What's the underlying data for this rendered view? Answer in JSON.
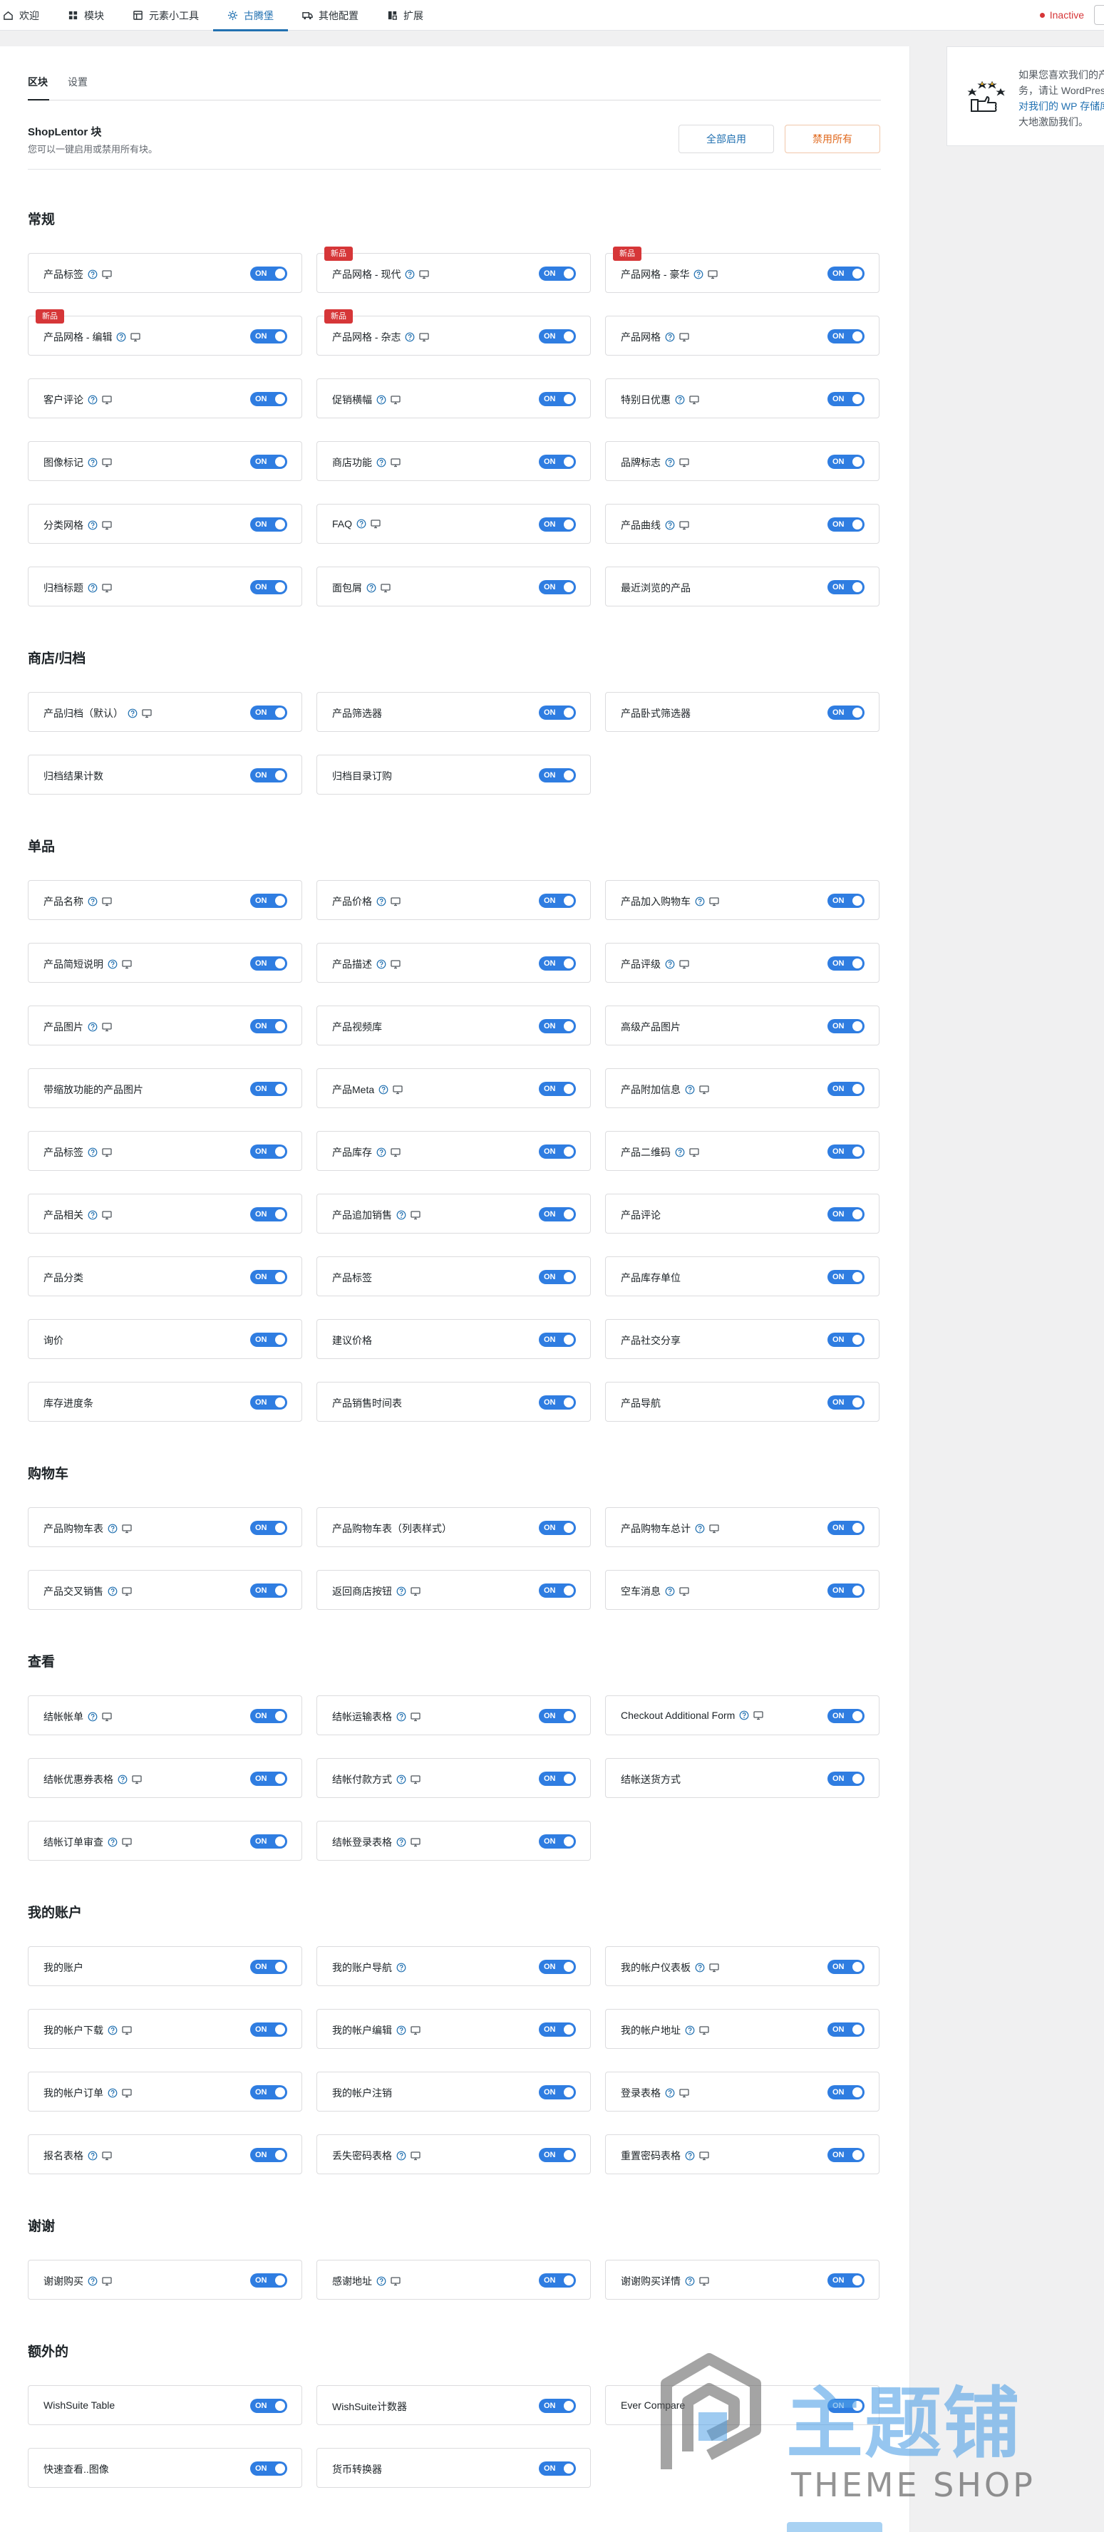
{
  "topnav": {
    "items": [
      {
        "label": "欢迎",
        "icon": "house-icon"
      },
      {
        "label": "模块",
        "icon": "grid-icon"
      },
      {
        "label": "元素小工具",
        "icon": "widgets-icon"
      },
      {
        "label": "古腾堡",
        "icon": "gear-icon"
      },
      {
        "label": "其他配置",
        "icon": "truck-icon"
      },
      {
        "label": "扩展",
        "icon": "extension-icon"
      }
    ],
    "active_index": 3,
    "status": "Inactive",
    "status_color": "#d63638",
    "accent_color": "#2271b1"
  },
  "sidebar": {
    "lines": [
      "如果您喜欢我们的产",
      "务，请让 WordPres",
      "对我们的 WP 存储库",
      "大地激励我们。"
    ],
    "icon": "rating-hand-icon"
  },
  "tabs": [
    {
      "label": "区块"
    },
    {
      "label": "设置"
    }
  ],
  "header": {
    "title": "ShopLentor 块",
    "desc": "您可以一键启用或禁用所有块。",
    "enable_all": "全部启用",
    "disable_all": "禁用所有"
  },
  "toggle_label": "ON",
  "sections": [
    {
      "title": "常规",
      "items": [
        {
          "label": "产品标签",
          "icons": [
            "help-icon",
            "desktop-icon"
          ]
        },
        {
          "label": "产品网格 - 现代",
          "badge": "新品",
          "icons": [
            "help-icon",
            "desktop-icon"
          ]
        },
        {
          "label": "产品网格 - 豪华",
          "badge": "新品",
          "icons": [
            "help-icon",
            "desktop-icon"
          ]
        },
        {
          "label": "产品网格 - 编辑",
          "badge": "新品",
          "icons": [
            "help-icon",
            "desktop-icon"
          ]
        },
        {
          "label": "产品网格 - 杂志",
          "badge": "新品",
          "icons": [
            "help-icon",
            "desktop-icon"
          ]
        },
        {
          "label": "产品网格",
          "icons": [
            "help-icon",
            "desktop-icon"
          ]
        },
        {
          "label": "客户评论",
          "icons": [
            "help-icon",
            "desktop-icon"
          ]
        },
        {
          "label": "促销横幅",
          "icons": [
            "help-icon",
            "desktop-icon"
          ]
        },
        {
          "label": "特别日优惠",
          "icons": [
            "help-icon",
            "desktop-icon"
          ]
        },
        {
          "label": "图像标记",
          "icons": [
            "help-icon",
            "desktop-icon"
          ]
        },
        {
          "label": "商店功能",
          "icons": [
            "help-icon",
            "desktop-icon"
          ]
        },
        {
          "label": "品牌标志",
          "icons": [
            "help-icon",
            "desktop-icon"
          ]
        },
        {
          "label": "分类网格",
          "icons": [
            "help-icon",
            "desktop-icon"
          ]
        },
        {
          "label": "FAQ",
          "icons": [
            "help-icon",
            "desktop-icon"
          ]
        },
        {
          "label": "产品曲线",
          "icons": [
            "help-icon",
            "desktop-icon"
          ]
        },
        {
          "label": "归档标题",
          "icons": [
            "help-icon",
            "desktop-icon"
          ]
        },
        {
          "label": "面包屑",
          "icons": [
            "help-icon",
            "desktop-icon"
          ]
        },
        {
          "label": "最近浏览的产品",
          "icons": []
        }
      ]
    },
    {
      "title": "商店/归档",
      "items": [
        {
          "label": "产品归档（默认）",
          "icons": [
            "help-icon",
            "desktop-icon"
          ]
        },
        {
          "label": "产品筛选器",
          "icons": []
        },
        {
          "label": "产品卧式筛选器",
          "icons": []
        },
        {
          "label": "归档结果计数",
          "icons": []
        },
        {
          "label": "归档目录订购",
          "icons": []
        }
      ]
    },
    {
      "title": "单品",
      "items": [
        {
          "label": "产品名称",
          "icons": [
            "help-icon",
            "desktop-icon"
          ]
        },
        {
          "label": "产品价格",
          "icons": [
            "help-icon",
            "desktop-icon"
          ]
        },
        {
          "label": "产品加入购物车",
          "icons": [
            "help-icon",
            "desktop-icon"
          ]
        },
        {
          "label": "产品简短说明",
          "icons": [
            "help-icon",
            "desktop-icon"
          ]
        },
        {
          "label": "产品描述",
          "icons": [
            "help-icon",
            "desktop-icon"
          ]
        },
        {
          "label": "产品评级",
          "icons": [
            "help-icon",
            "desktop-icon"
          ]
        },
        {
          "label": "产品图片",
          "icons": [
            "help-icon",
            "desktop-icon"
          ]
        },
        {
          "label": "产品视频库",
          "icons": []
        },
        {
          "label": "高级产品图片",
          "icons": []
        },
        {
          "label": "带缩放功能的产品图片",
          "icons": []
        },
        {
          "label": "产品Meta",
          "icons": [
            "help-icon",
            "desktop-icon"
          ]
        },
        {
          "label": "产品附加信息",
          "icons": [
            "help-icon",
            "desktop-icon"
          ]
        },
        {
          "label": "产品标签",
          "icons": [
            "help-icon",
            "desktop-icon"
          ]
        },
        {
          "label": "产品库存",
          "icons": [
            "help-icon",
            "desktop-icon"
          ]
        },
        {
          "label": "产品二维码",
          "icons": [
            "help-icon",
            "desktop-icon"
          ]
        },
        {
          "label": "产品相关",
          "icons": [
            "help-icon",
            "desktop-icon"
          ]
        },
        {
          "label": "产品追加销售",
          "icons": [
            "help-icon",
            "desktop-icon"
          ]
        },
        {
          "label": "产品评论",
          "icons": []
        },
        {
          "label": "产品分类",
          "icons": []
        },
        {
          "label": "产品标签",
          "icons": []
        },
        {
          "label": "产品库存单位",
          "icons": []
        },
        {
          "label": "询价",
          "icons": []
        },
        {
          "label": "建议价格",
          "icons": []
        },
        {
          "label": "产品社交分享",
          "icons": []
        },
        {
          "label": "库存进度条",
          "icons": []
        },
        {
          "label": "产品销售时间表",
          "icons": []
        },
        {
          "label": "产品导航",
          "icons": []
        }
      ]
    },
    {
      "title": "购物车",
      "items": [
        {
          "label": "产品购物车表",
          "icons": [
            "help-icon",
            "desktop-icon"
          ]
        },
        {
          "label": "产品购物车表（列表样式）",
          "icons": []
        },
        {
          "label": "产品购物车总计",
          "icons": [
            "help-icon",
            "desktop-icon"
          ]
        },
        {
          "label": "产品交叉销售",
          "icons": [
            "help-icon",
            "desktop-icon"
          ]
        },
        {
          "label": "返回商店按钮",
          "icons": [
            "help-icon",
            "desktop-icon"
          ]
        },
        {
          "label": "空车消息",
          "icons": [
            "help-icon",
            "desktop-icon"
          ]
        }
      ]
    },
    {
      "title": "查看",
      "items": [
        {
          "label": "结帐帐单",
          "icons": [
            "help-icon",
            "desktop-icon"
          ]
        },
        {
          "label": "结帐运输表格",
          "icons": [
            "help-icon",
            "desktop-icon"
          ]
        },
        {
          "label": "Checkout Additional Form",
          "icons": [
            "help-icon",
            "desktop-icon"
          ]
        },
        {
          "label": "结帐优惠券表格",
          "icons": [
            "help-icon",
            "desktop-icon"
          ]
        },
        {
          "label": "结帐付款方式",
          "icons": [
            "help-icon",
            "desktop-icon"
          ]
        },
        {
          "label": "结帐送货方式",
          "icons": []
        },
        {
          "label": "结帐订单审查",
          "icons": [
            "help-icon",
            "desktop-icon"
          ]
        },
        {
          "label": "结帐登录表格",
          "icons": [
            "help-icon",
            "desktop-icon"
          ]
        }
      ]
    },
    {
      "title": "我的账户",
      "items": [
        {
          "label": "我的账户",
          "icons": []
        },
        {
          "label": "我的账户导航",
          "icons": [
            "help-icon"
          ]
        },
        {
          "label": "我的帐户仪表板",
          "icons": [
            "help-icon",
            "desktop-icon"
          ]
        },
        {
          "label": "我的帐户下载",
          "icons": [
            "help-icon",
            "desktop-icon"
          ]
        },
        {
          "label": "我的帐户编辑",
          "icons": [
            "help-icon",
            "desktop-icon"
          ]
        },
        {
          "label": "我的帐户地址",
          "icons": [
            "help-icon",
            "desktop-icon"
          ]
        },
        {
          "label": "我的帐户订单",
          "icons": [
            "help-icon",
            "desktop-icon"
          ]
        },
        {
          "label": "我的帐户注销",
          "icons": []
        },
        {
          "label": "登录表格",
          "icons": [
            "help-icon",
            "desktop-icon"
          ]
        },
        {
          "label": "报名表格",
          "icons": [
            "help-icon",
            "desktop-icon"
          ]
        },
        {
          "label": "丢失密码表格",
          "icons": [
            "help-icon",
            "desktop-icon"
          ]
        },
        {
          "label": "重置密码表格",
          "icons": [
            "help-icon",
            "desktop-icon"
          ]
        }
      ]
    },
    {
      "title": "谢谢",
      "items": [
        {
          "label": "谢谢购买",
          "icons": [
            "help-icon",
            "desktop-icon"
          ]
        },
        {
          "label": "感谢地址",
          "icons": [
            "help-icon",
            "desktop-icon"
          ]
        },
        {
          "label": "谢谢购买详情",
          "icons": [
            "help-icon",
            "desktop-icon"
          ]
        }
      ]
    },
    {
      "title": "额外的",
      "items": [
        {
          "label": "WishSuite Table",
          "icons": []
        },
        {
          "label": "WishSuite计数器",
          "icons": []
        },
        {
          "label": "Ever Compare",
          "icons": []
        },
        {
          "label": "快速查看..图像",
          "icons": []
        },
        {
          "label": "货币转换器",
          "icons": []
        }
      ]
    }
  ],
  "watermark": {
    "cn": "主题铺",
    "en": "THEME SHOP"
  }
}
